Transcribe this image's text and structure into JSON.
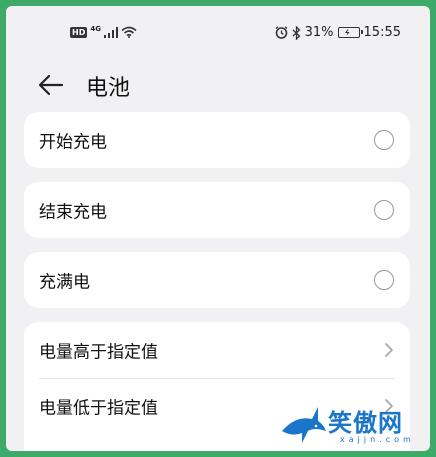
{
  "status_bar": {
    "hd_badge": "HD",
    "network_type": "4G",
    "battery_percent": "31%",
    "time": "15:55",
    "icons": [
      "signal-icon",
      "wifi-icon",
      "alarm-icon",
      "bluetooth-icon",
      "battery-icon"
    ]
  },
  "header": {
    "title": "电池",
    "back_icon": "arrow-left-icon"
  },
  "cards": [
    {
      "label": "开始充电",
      "control": "radio",
      "selected": false
    },
    {
      "label": "结束充电",
      "control": "radio",
      "selected": false
    },
    {
      "label": "充满电",
      "control": "radio",
      "selected": false
    }
  ],
  "menu_group": [
    {
      "label": "电量高于指定值",
      "control": "chevron"
    },
    {
      "label": "电量低于指定值",
      "control": "chevron"
    }
  ],
  "watermark": {
    "text": "笑傲网",
    "sub": "xajjn.com"
  },
  "colors": {
    "frame_border": "#3daa6a",
    "background": "#f1f1f3",
    "card": "#ffffff",
    "watermark": "#1b75c9"
  }
}
